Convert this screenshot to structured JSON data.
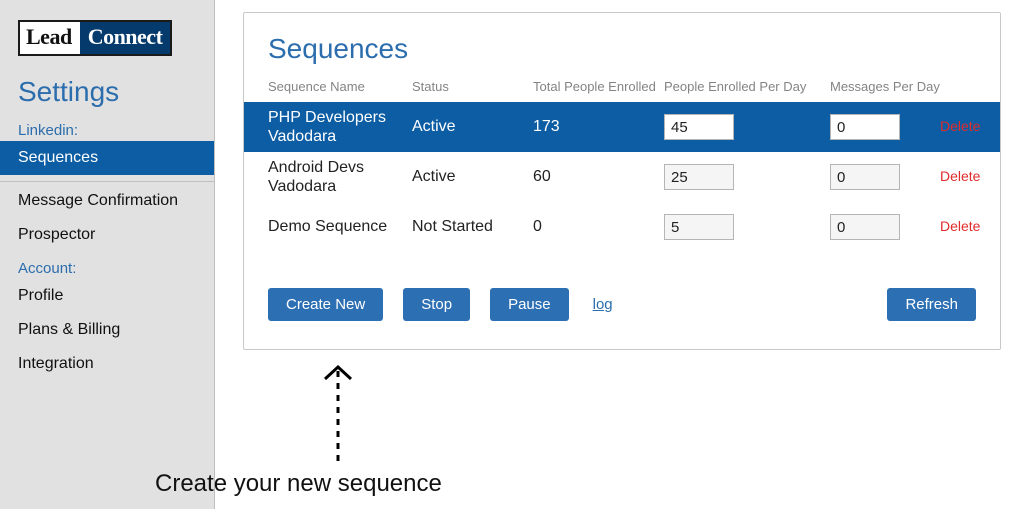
{
  "logo": {
    "lead": "Lead",
    "connect": "Connect"
  },
  "sidebar": {
    "title": "Settings",
    "section1": "Linkedin:",
    "section2": "Account:",
    "items": {
      "sequences": "Sequences",
      "messageConfirmation": "Message Confirmation",
      "prospector": "Prospector",
      "profile": "Profile",
      "plansBilling": "Plans & Billing",
      "integration": "Integration"
    }
  },
  "panel": {
    "title": "Sequences",
    "headers": {
      "name": "Sequence Name",
      "status": "Status",
      "total": "Total People Enrolled",
      "ppd": "People Enrolled Per Day",
      "mpd": "Messages Per Day"
    },
    "rows": [
      {
        "name": "PHP Developers Vadodara",
        "status": "Active",
        "total": "173",
        "ppd": "45",
        "mpd": "0",
        "delete": "Delete"
      },
      {
        "name": "Android Devs Vadodara",
        "status": "Active",
        "total": "60",
        "ppd": "25",
        "mpd": "0",
        "delete": "Delete"
      },
      {
        "name": "Demo Sequence",
        "status": "Not Started",
        "total": "0",
        "ppd": "5",
        "mpd": "0",
        "delete": "Delete"
      }
    ],
    "buttons": {
      "create": "Create New",
      "stop": "Stop",
      "pause": "Pause",
      "log": "log",
      "refresh": "Refresh"
    }
  },
  "annotation": "Create your new sequence"
}
